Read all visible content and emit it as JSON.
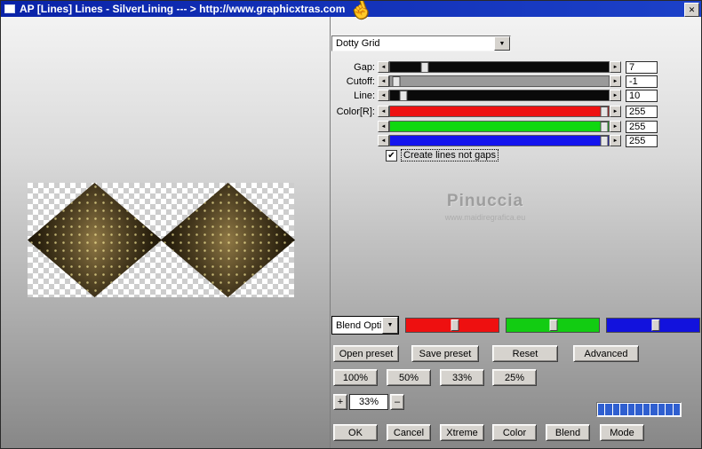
{
  "window": {
    "title": "AP [Lines]  Lines - SilverLining   --- > http://www.graphicxtras.com",
    "close_glyph": "✕"
  },
  "icons": {
    "hand": "☝",
    "dropdown_arrow": "▼",
    "arrow_left": "◄",
    "arrow_right": "►",
    "check": "✔",
    "stepper_plus": "+",
    "stepper_minus": "–"
  },
  "filter_combo": {
    "selected": "Dotty Grid"
  },
  "param_sliders": {
    "rows": [
      {
        "label": "Gap:",
        "value": "7",
        "track_color": "#0a0a0a",
        "thumb_pct": 16
      },
      {
        "label": "Cutoff:",
        "value": "-1",
        "track_color": "#9a9a9a",
        "thumb_pct": 3
      },
      {
        "label": "Line:",
        "value": "10",
        "track_color": "#0a0a0a",
        "thumb_pct": 6
      },
      {
        "label": "Color[R]:",
        "value": "255",
        "track_color": "#ee1212",
        "thumb_pct": 98
      },
      {
        "label": "",
        "value": "255",
        "track_color": "#10d810",
        "thumb_pct": 98
      },
      {
        "label": "",
        "value": "255",
        "track_color": "#1414ee",
        "thumb_pct": 98
      }
    ]
  },
  "options": {
    "create_lines_checkbox": "Create lines not gaps"
  },
  "watermark": {
    "name": "Pinuccia",
    "site": "www.maidiregrafica.eu"
  },
  "blend": {
    "combo_label": "Blend Opti",
    "sliders": [
      {
        "name": "red",
        "color": "#ee1010",
        "thumb_pct": 53
      },
      {
        "name": "green",
        "color": "#12cc12",
        "thumb_pct": 51
      },
      {
        "name": "blue",
        "color": "#1212dd",
        "thumb_pct": 53
      }
    ]
  },
  "preset_buttons": [
    "Open preset",
    "Save preset",
    "Reset",
    "Advanced"
  ],
  "zoom_buttons": [
    "100%",
    "50%",
    "33%",
    "25%"
  ],
  "zoom_stepper": {
    "value": "33%"
  },
  "action_buttons": [
    "OK",
    "Cancel",
    "Xtreme",
    "Color",
    "Blend",
    "Mode"
  ],
  "progress": {
    "segments": 11,
    "color": "#2f5fd0"
  }
}
